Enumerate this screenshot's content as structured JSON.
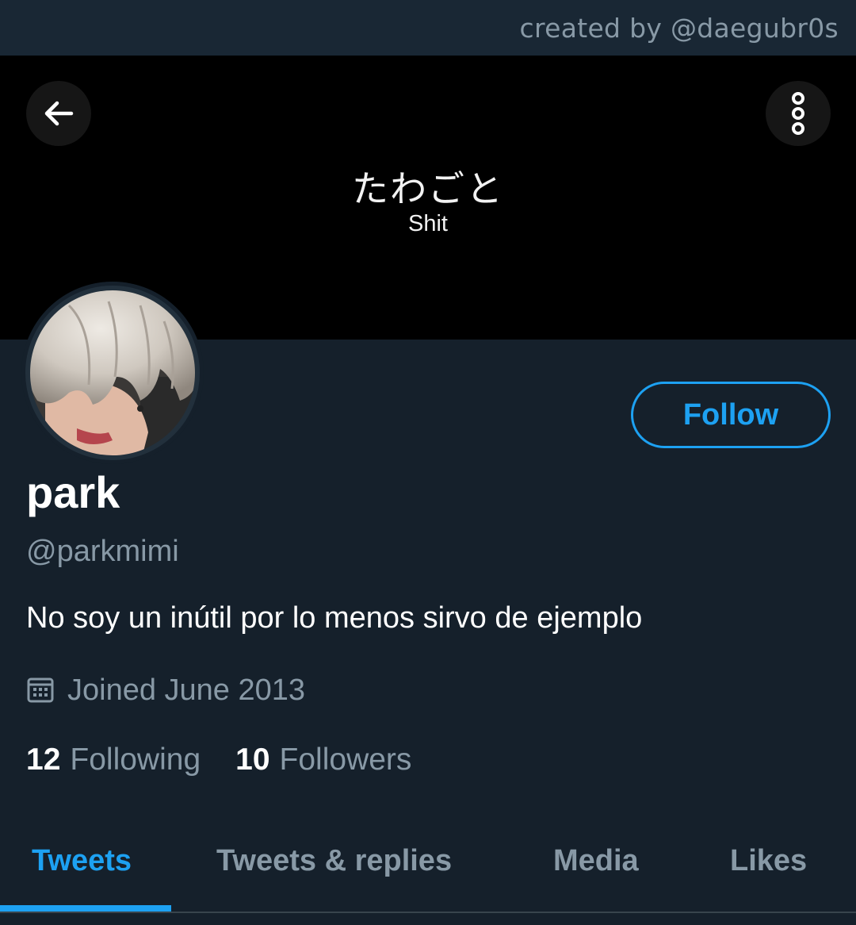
{
  "credit": "created by @daegubr0s",
  "banner": {
    "title": "たわごと",
    "subtitle": "Shit"
  },
  "profile": {
    "display_name": "park",
    "handle": "@parkmimi",
    "bio": "No soy un inútil por lo menos sirvo de ejemplo",
    "joined": "Joined June 2013",
    "following_count": "12",
    "following_label": "Following",
    "followers_count": "10",
    "followers_label": "Followers"
  },
  "actions": {
    "follow_label": "Follow"
  },
  "tabs": [
    {
      "label": "Tweets",
      "active": true
    },
    {
      "label": "Tweets & replies",
      "active": false
    },
    {
      "label": "Media",
      "active": false
    },
    {
      "label": "Likes",
      "active": false
    }
  ],
  "icons": {
    "back": "arrow-left-icon",
    "more": "more-vertical-icon",
    "calendar": "calendar-icon"
  },
  "colors": {
    "accent": "#1da1f2",
    "background": "#15202b",
    "secondary_text": "#8899a6"
  }
}
